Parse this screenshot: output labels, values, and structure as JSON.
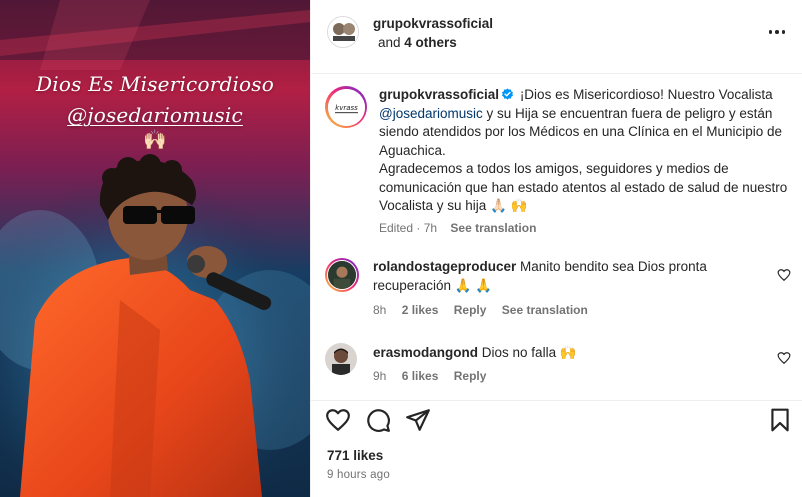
{
  "media": {
    "overlay_title": "Dios Es Misericordioso",
    "overlay_handle": "@josedariomusic",
    "overlay_emoji": "🙌🏻"
  },
  "header": {
    "username": "grupokvrassoficial",
    "and_text": "and",
    "others_count": "4 others",
    "more_icon": "more-horizontal-icon"
  },
  "caption": {
    "username": "grupokvrassoficial",
    "verified_icon": "verified-badge-icon",
    "text_1": "¡Dios es Misericordioso! Nuestro Vocalista",
    "mention": "@josedariomusic",
    "text_2": "y su Hija se encuentran fuera de peligro y están siendo atendidos por los Médicos en una Clínica en el Municipio de Aguachica.",
    "text_3": "Agradecemos a todos los amigos, seguidores y medios de comunicación que han estado atentos al estado de salud de nuestro Vocalista y su hija 🙏🏻 🙌",
    "edited": "Edited · 7h",
    "see_translation": "See translation"
  },
  "comments": [
    {
      "username": "rolandostageproducer",
      "text": "Manito bendito sea Dios pronta recuperación 🙏 🙏",
      "time": "8h",
      "likes": "2 likes",
      "reply": "Reply",
      "see_translation": "See translation"
    },
    {
      "username": "erasmodangond",
      "text": "Dios no falla 🙌",
      "time": "9h",
      "likes": "6 likes",
      "reply": "Reply"
    }
  ],
  "actions": {
    "like_icon": "heart-icon",
    "comment_icon": "comment-icon",
    "share_icon": "send-icon",
    "save_icon": "bookmark-icon"
  },
  "stats": {
    "likes": "771 likes",
    "posted": "9 hours ago"
  },
  "colors": {
    "mention": "#00376b",
    "verified": "#0095f6",
    "secondary_text": "#737373",
    "text": "#262626"
  }
}
